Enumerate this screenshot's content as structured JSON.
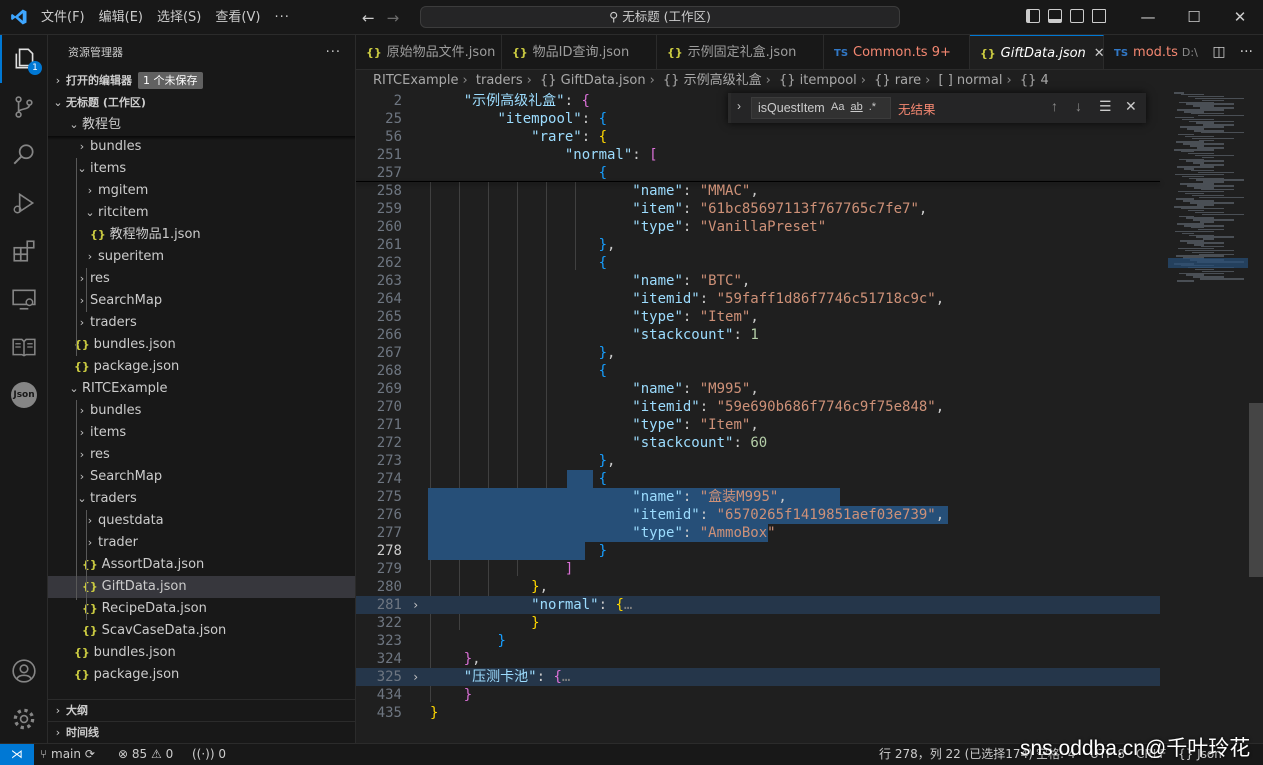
{
  "titlebar": {
    "menu": [
      "文件(F)",
      "编辑(E)",
      "选择(S)",
      "查看(V)",
      "···"
    ],
    "command_center": "⚲ 无标题 (工作区)"
  },
  "activity": {
    "explorer_badge": "1",
    "json_label": "Json"
  },
  "sidebar": {
    "title": "资源管理器",
    "open_editors": {
      "label": "打开的编辑器",
      "badge": "1 个未保存"
    },
    "workspace": "无标题 (工作区)",
    "tree": [
      {
        "label": "教程包",
        "depth": 1,
        "twisty": "⌄",
        "type": "folder"
      },
      {
        "label": "bundles",
        "depth": 2,
        "twisty": "›",
        "type": "folder"
      },
      {
        "label": "items",
        "depth": 2,
        "twisty": "⌄",
        "type": "folder"
      },
      {
        "label": "mgitem",
        "depth": 3,
        "twisty": "›",
        "type": "folder"
      },
      {
        "label": "ritcitem",
        "depth": 3,
        "twisty": "⌄",
        "type": "folder"
      },
      {
        "label": "教程物品1.json",
        "depth": 4,
        "twisty": "",
        "type": "json"
      },
      {
        "label": "superitem",
        "depth": 3,
        "twisty": "›",
        "type": "folder"
      },
      {
        "label": "res",
        "depth": 2,
        "twisty": "›",
        "type": "folder"
      },
      {
        "label": "SearchMap",
        "depth": 2,
        "twisty": "›",
        "type": "folder"
      },
      {
        "label": "traders",
        "depth": 2,
        "twisty": "›",
        "type": "folder"
      },
      {
        "label": "bundles.json",
        "depth": 2,
        "twisty": "",
        "type": "json"
      },
      {
        "label": "package.json",
        "depth": 2,
        "twisty": "",
        "type": "json"
      },
      {
        "label": "RITCExample",
        "depth": 1,
        "twisty": "⌄",
        "type": "folder"
      },
      {
        "label": "bundles",
        "depth": 2,
        "twisty": "›",
        "type": "folder"
      },
      {
        "label": "items",
        "depth": 2,
        "twisty": "›",
        "type": "folder"
      },
      {
        "label": "res",
        "depth": 2,
        "twisty": "›",
        "type": "folder"
      },
      {
        "label": "SearchMap",
        "depth": 2,
        "twisty": "›",
        "type": "folder"
      },
      {
        "label": "traders",
        "depth": 2,
        "twisty": "⌄",
        "type": "folder"
      },
      {
        "label": "questdata",
        "depth": 3,
        "twisty": "›",
        "type": "folder"
      },
      {
        "label": "trader",
        "depth": 3,
        "twisty": "›",
        "type": "folder"
      },
      {
        "label": "AssortData.json",
        "depth": 3,
        "twisty": "",
        "type": "json"
      },
      {
        "label": "GiftData.json",
        "depth": 3,
        "twisty": "",
        "type": "json",
        "selected": true
      },
      {
        "label": "RecipeData.json",
        "depth": 3,
        "twisty": "",
        "type": "json"
      },
      {
        "label": "ScavCaseData.json",
        "depth": 3,
        "twisty": "",
        "type": "json"
      },
      {
        "label": "bundles.json",
        "depth": 2,
        "twisty": "",
        "type": "json"
      },
      {
        "label": "package.json",
        "depth": 2,
        "twisty": "",
        "type": "json"
      }
    ],
    "outline": "大纲",
    "timeline": "时间线"
  },
  "tabs": [
    {
      "icon": "{}",
      "label": "原始物品文件.json"
    },
    {
      "icon": "{}",
      "label": "物品ID查询.json"
    },
    {
      "icon": "{}",
      "label": "示例固定礼盒.json"
    },
    {
      "icon": "TS",
      "label": "Common.ts",
      "badge": "9+"
    },
    {
      "icon": "{}",
      "label": "GiftData.json",
      "active": true
    },
    {
      "icon": "TS",
      "label": "mod.ts",
      "path": "D:\\"
    }
  ],
  "breadcrumb": [
    "RITCExample",
    "traders",
    "{} GiftData.json",
    "{} 示例高级礼盒",
    "{} itempool",
    "{} rare",
    "[ ] normal",
    "{} 4"
  ],
  "find": {
    "query": "isQuestItem",
    "opts": [
      "Aa",
      "ab",
      ".*"
    ],
    "result": "无结果"
  },
  "status": {
    "branch": "main",
    "errors": "85",
    "warnings": "0",
    "ports": "0",
    "cursor": "行 278，列 22 (已选择174)",
    "spaces": "空格: 4",
    "encoding": "UTF-8",
    "eol": "CRLF",
    "language": "{} Json"
  },
  "watermark": "sns.oddba.cn@千叶玲花"
}
